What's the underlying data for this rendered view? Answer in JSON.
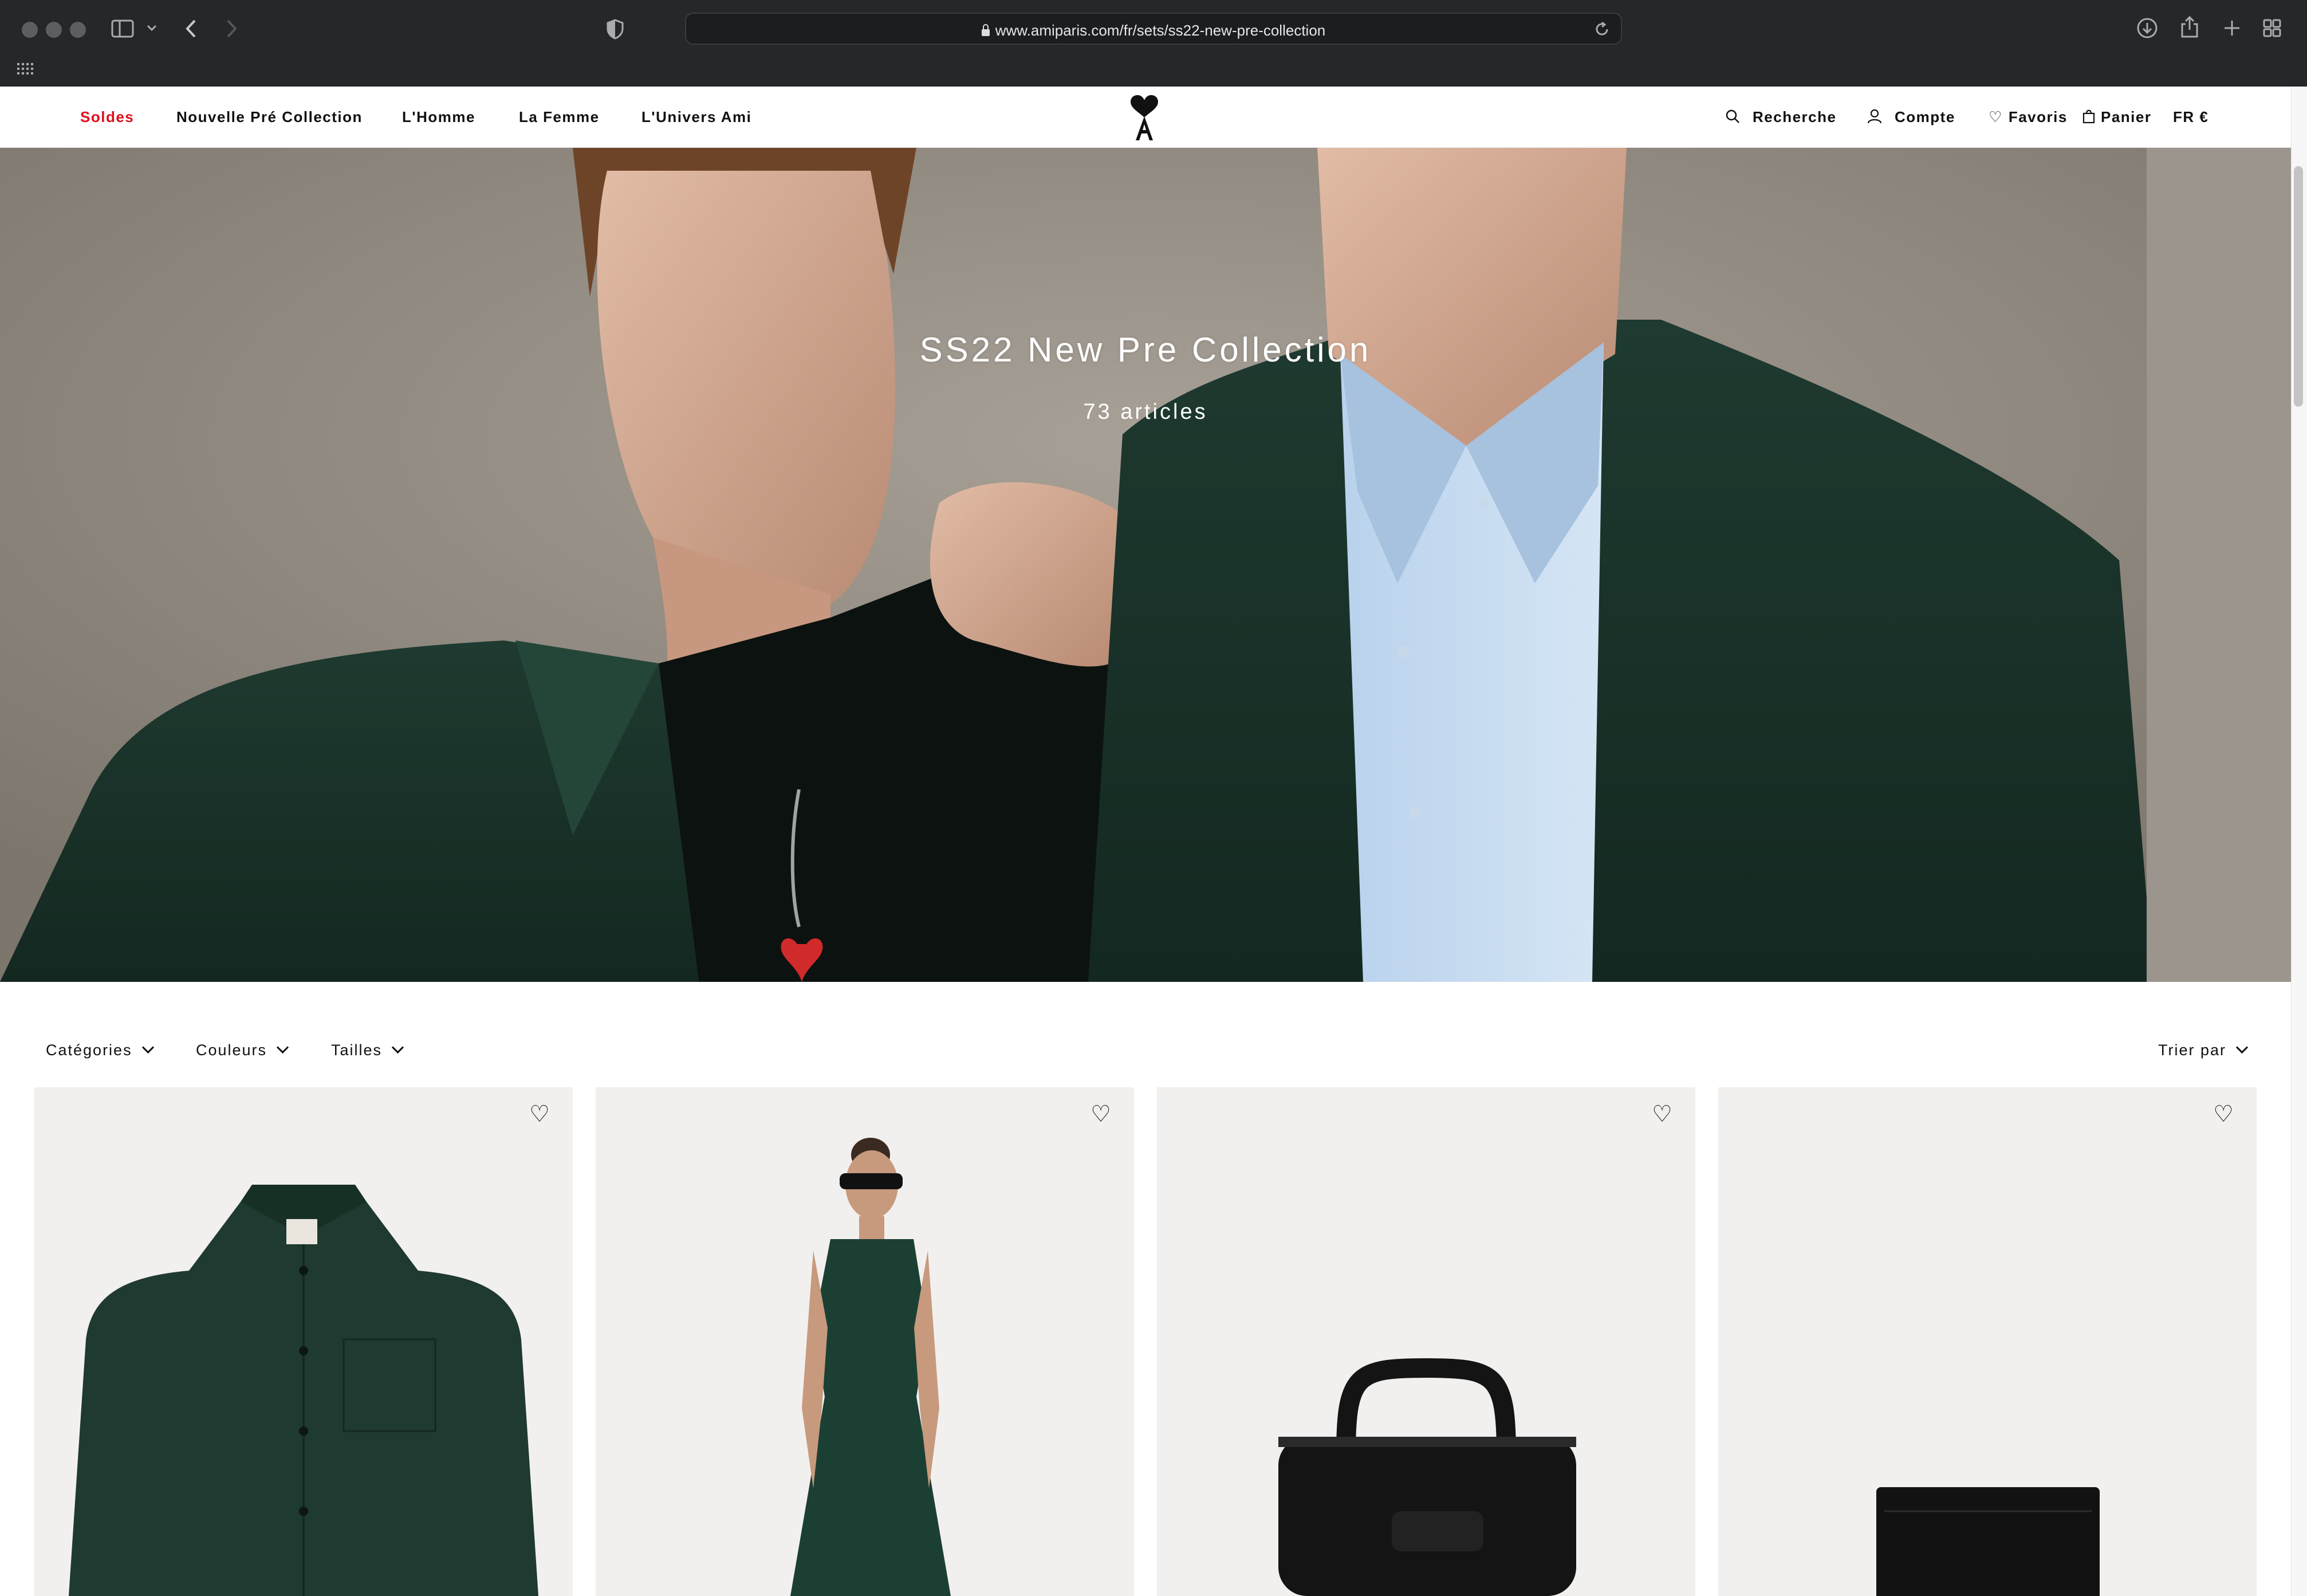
{
  "browser": {
    "url": "www.amiparis.com/fr/sets/ss22-new-pre-collection",
    "icons": [
      "sidebar-icon",
      "back-icon",
      "forward-icon",
      "shield-icon",
      "lock-icon",
      "reload-icon",
      "download-icon",
      "share-icon",
      "new-tab-icon",
      "tab-overview-icon",
      "grid-icon"
    ]
  },
  "nav": {
    "items": [
      "Soldes",
      "Nouvelle Pré Collection",
      "L'Homme",
      "La Femme",
      "L'Univers Ami"
    ],
    "sale_color": "#e0101e",
    "utility": {
      "search": "Recherche",
      "account": "Compte",
      "favorites": "Favoris",
      "cart": "Panier",
      "locale": "FR €"
    }
  },
  "hero": {
    "title": "SS22 New Pre Collection",
    "count": "73 articles"
  },
  "filters": {
    "categories": "Catégories",
    "colors": "Couleurs",
    "sizes": "Tailles",
    "sort": "Trier par"
  },
  "products": [
    {
      "kind": "suede jacket",
      "color": "#1f3a30"
    },
    {
      "kind": "sleeveless dress",
      "color": "#1c3f34"
    },
    {
      "kind": "leather bag",
      "color": "#141414"
    },
    {
      "kind": "card holder",
      "color": "#121212"
    }
  ]
}
